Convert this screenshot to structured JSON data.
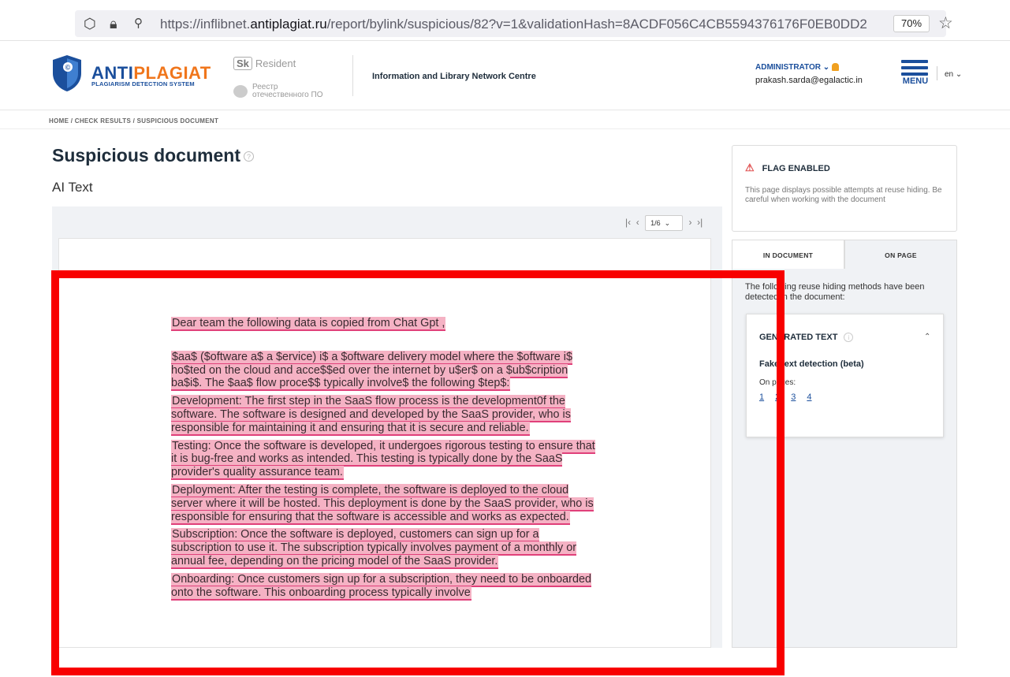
{
  "browser": {
    "url_prefix": "https://inflibnet.",
    "url_domain": "antiplagiat.ru",
    "url_suffix": "/report/bylink/suspicious/82?v=1&validationHash=8ACDF056C4CB5594376176F0EB0DD2",
    "zoom": "70%"
  },
  "header": {
    "brand": "ANTIPLAGIAT",
    "brand_part_a": "ANTI",
    "brand_part_b": "PLAGIAT",
    "brand_sub": "PLAGIARISM DETECTION SYSTEM",
    "sk_label": "Sk",
    "resident": "Resident",
    "reestr_line1": "Реестр",
    "reestr_line2": "отечественного ПО",
    "organization": "Information and Library Network Centre",
    "role": "ADMINISTRATOR",
    "email": "prakash.sarda@egalactic.in",
    "menu_label": "MENU",
    "language": "en"
  },
  "breadcrumb": "HOME / CHECK RESULTS / SUSPICIOUS DOCUMENT",
  "page_title": "Suspicious document",
  "subtitle": "AI Text",
  "pager": {
    "page": "1/6"
  },
  "document": {
    "para1": "Dear team the following data is copied from Chat Gpt ,",
    "para2": "$aa$ ($oftware a$ a $ervice) i$ a $oftware delivery model where the $oftware i$ ho$ted on the cloud and acce$$ed over the internet by u$er$ on a $ub$cription ba$i$. The $aa$ flow proce$$ typically involve$ the following $tep$:",
    "para3": " Development: The first step in the SaaS flow process is the development0f the software. The software is designed and developed by the SaaS provider, who is responsible for maintaining it and ensuring that it is secure and reliable.",
    "para4": "Testing: Once the software is developed, it undergoes rigorous testing to ensure that it is bug-free and works as intended. This testing is typically done by the SaaS provider's quality assurance team.",
    "para5": "Deployment: After the testing is complete, the software is deployed to the cloud server where it will be hosted. This deployment is done by the SaaS provider, who is responsible for ensuring that the software is accessible and works as expected.",
    "para6": "Subscription: Once the software is deployed, customers can sign up for a subscription to use it. The subscription typically involves payment of a monthly or annual fee, depending on the pricing model of the SaaS provider.",
    "para7": "Onboarding: Once customers sign up for a subscription, they need to be onboarded onto the software. This onboarding process typically involve"
  },
  "flag": {
    "title": "FLAG ENABLED",
    "description": "This page displays possible attempts at reuse hiding. Be careful when working with the document"
  },
  "tabs": {
    "in_document": "IN DOCUMENT",
    "on_page": "ON PAGE"
  },
  "panel": {
    "intro": "The following reuse hiding methods have been detected in the document:",
    "generated_title": "GENERATED TEXT",
    "fake_label": "Fake text detection (beta)",
    "on_pages_label": "On pages:",
    "pages": [
      "1",
      "2",
      "3",
      "4"
    ]
  },
  "colors": {
    "brand_blue": "#1b4f9c",
    "brand_orange": "#f0761c",
    "highlight": "#f5b2c4",
    "annotation_red": "#f80000"
  }
}
